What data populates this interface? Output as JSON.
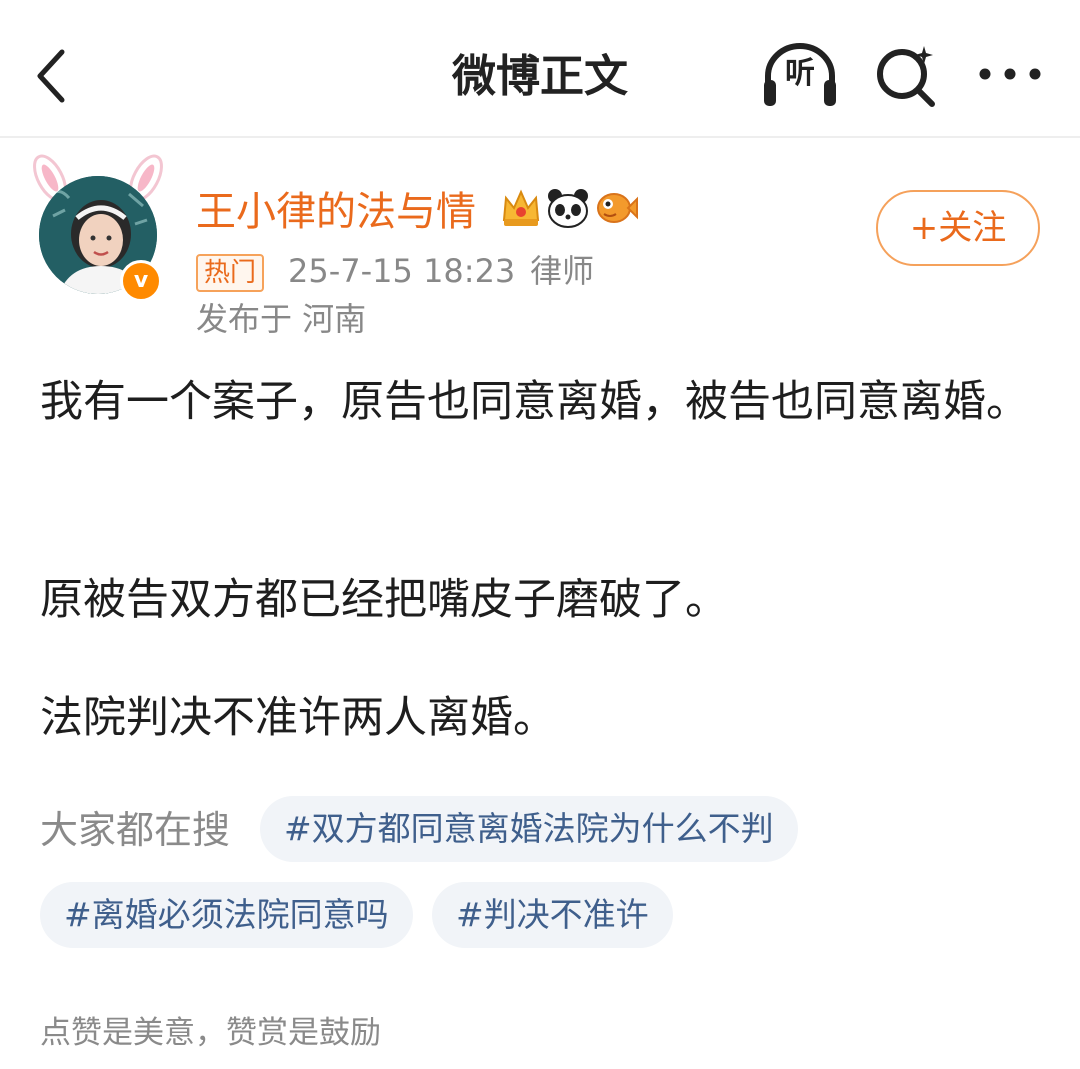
{
  "header": {
    "title": "微博正文",
    "listen_label": "听"
  },
  "author": {
    "name": "王小律的法与情",
    "verify_mark": "v",
    "hot_tag": "热门",
    "timestamp": "25-7-15 18:23",
    "role": "律师",
    "location": "发布于 河南",
    "follow_label": "+关注"
  },
  "post": {
    "paragraphs": [
      "我有一个案子，原告也同意离婚，被告也同意离婚。",
      "原被告双方都已经把嘴皮子磨破了。",
      "法院判决不准许两人离婚。"
    ]
  },
  "search": {
    "label": "大家都在搜",
    "tags": [
      "#双方都同意离婚法院为什么不判",
      "#离婚必须法院同意吗",
      "#判决不准许"
    ]
  },
  "footer": {
    "note": "点赞是美意，赞赏是鼓励"
  },
  "colors": {
    "accent_orange": "#ea6a1c",
    "tag_blue": "#3f5f8c",
    "muted_gray": "#8a8a8a"
  },
  "icons": [
    "back-arrow-icon",
    "headphones-icon",
    "search-icon",
    "more-icon",
    "crown-icon",
    "panda-icon",
    "fish-icon",
    "bunny-ears-icon"
  ]
}
